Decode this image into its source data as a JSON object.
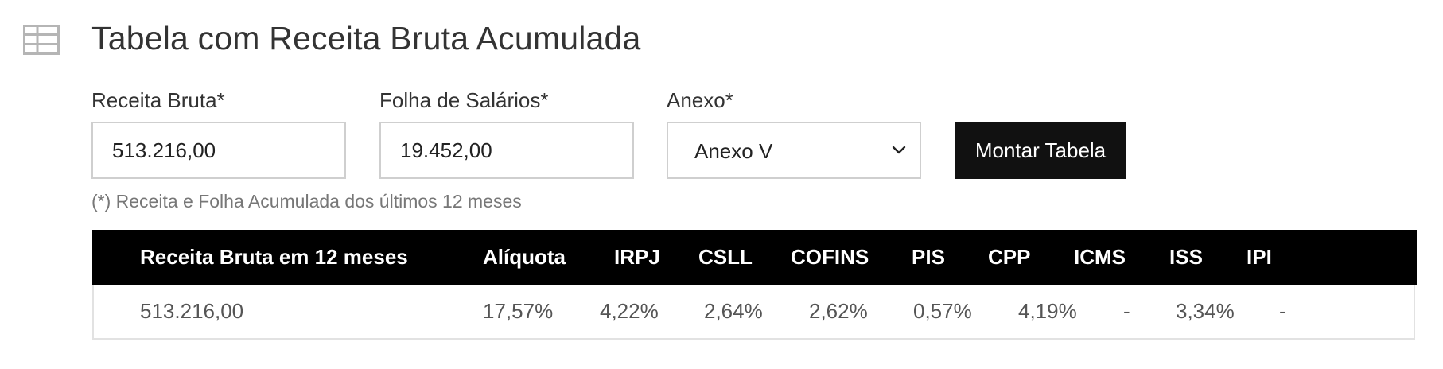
{
  "header": {
    "icon": "table-icon",
    "title": "Tabela com Receita Bruta Acumulada"
  },
  "form": {
    "receita": {
      "label": "Receita Bruta*",
      "value": "513.216,00"
    },
    "folha": {
      "label": "Folha de Salários*",
      "value": "19.452,00"
    },
    "anexo": {
      "label": "Anexo*",
      "value": "Anexo V",
      "icon": "chevron-down-icon"
    },
    "submit_label": "Montar Tabela",
    "footnote": "(*) Receita e Folha Acumulada dos últimos 12 meses"
  },
  "table": {
    "columns": {
      "receita": "Receita Bruta em 12 meses",
      "aliquota": "Alíquota",
      "irpj": "IRPJ",
      "csll": "CSLL",
      "cofins": "COFINS",
      "pis": "PIS",
      "cpp": "CPP",
      "icms": "ICMS",
      "iss": "ISS",
      "ipi": "IPI"
    },
    "row": {
      "receita": "513.216,00",
      "aliquota": "17,57%",
      "irpj": "4,22%",
      "csll": "2,64%",
      "cofins": "2,62%",
      "pis": "0,57%",
      "cpp": "4,19%",
      "icms": "-",
      "iss": "3,34%",
      "ipi": "-"
    }
  },
  "colors": {
    "header_background": "#000000",
    "button_background": "#111111",
    "input_border": "#cfcfcf",
    "footnote_text": "#777777"
  }
}
